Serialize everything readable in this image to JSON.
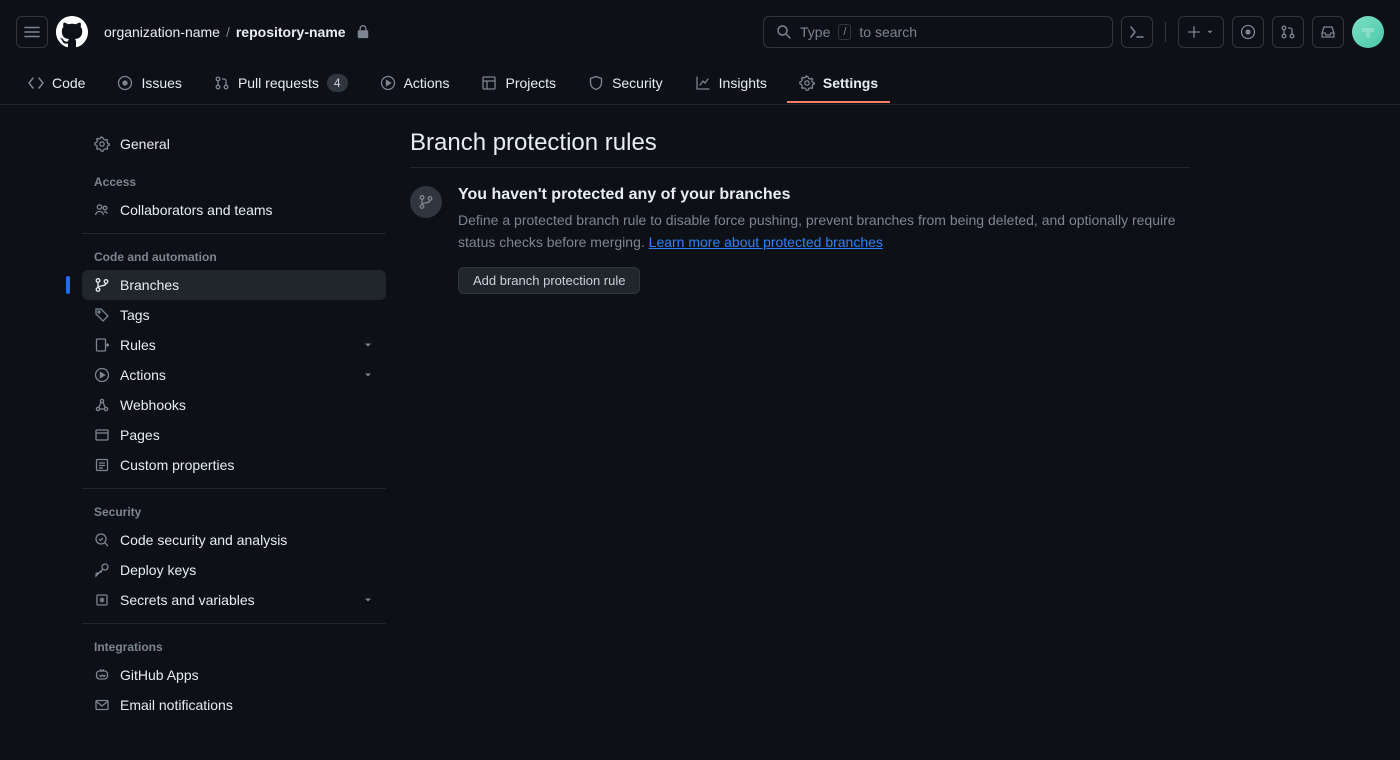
{
  "header": {
    "org": "organization-name",
    "repo": "repository-name",
    "search_pre": "Type",
    "search_kbd": "/",
    "search_post": "to search"
  },
  "tabs": {
    "code": "Code",
    "issues": "Issues",
    "pulls": "Pull requests",
    "pulls_count": "4",
    "actions": "Actions",
    "projects": "Projects",
    "security": "Security",
    "insights": "Insights",
    "settings": "Settings"
  },
  "sidebar": {
    "general": "General",
    "groups": {
      "access": "Access",
      "code": "Code and automation",
      "security": "Security",
      "integrations": "Integrations"
    },
    "items": {
      "collab": "Collaborators and teams",
      "branches": "Branches",
      "tags": "Tags",
      "rules": "Rules",
      "actions": "Actions",
      "webhooks": "Webhooks",
      "pages": "Pages",
      "custom": "Custom properties",
      "codesec": "Code security and analysis",
      "deploy": "Deploy keys",
      "secrets": "Secrets and variables",
      "apps": "GitHub Apps",
      "email": "Email notifications"
    }
  },
  "main": {
    "title": "Branch protection rules",
    "bs_title": "You haven't protected any of your branches",
    "bs_desc": "Define a protected branch rule to disable force pushing, prevent branches from being deleted, and optionally require status checks before merging. ",
    "bs_link": "Learn more about protected branches",
    "button": "Add branch protection rule"
  }
}
